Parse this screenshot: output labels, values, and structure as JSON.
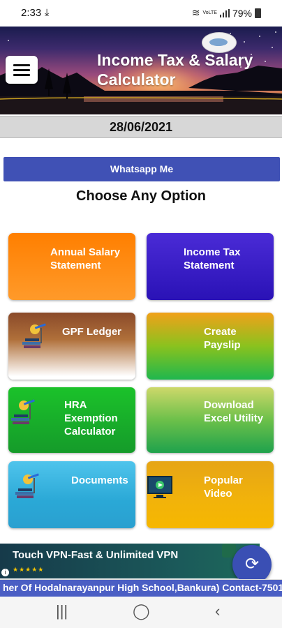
{
  "status_bar": {
    "time": "2:33",
    "network": "VoLTE",
    "battery": "79%"
  },
  "header": {
    "title_line1": "Income Tax & Salary",
    "title_line2": "Calculator"
  },
  "date": "28/06/2021",
  "whatsapp_label": "Whatsapp Me",
  "heading": "Choose Any Option",
  "options": {
    "annual": {
      "line1": "Annual Salary",
      "line2": "Statement"
    },
    "income": {
      "line1": "Income Tax",
      "line2": "Statement"
    },
    "gpf": {
      "line1": "GPF Ledger"
    },
    "payslip": {
      "line1": "Create",
      "line2": "Payslip"
    },
    "hra": {
      "line1": "HRA",
      "line2": "Exemption",
      "line3": "Calculator"
    },
    "excel": {
      "line1": "Download",
      "line2": "Excel Utility"
    },
    "docs": {
      "line1": "Documents"
    },
    "video": {
      "line1": "Popular",
      "line2": "Video"
    }
  },
  "ad": {
    "text": "Touch VPN-Fast & Unlimited VPN",
    "stars": "★★★★★"
  },
  "ticker_text": "her Of Hodalnarayanpur High School,Bankura)  Contact-7501",
  "icons": {
    "menu": "hamburger-icon",
    "fab": "refresh-icon",
    "tile_person": "teacher-books-icon",
    "tile_video": "video-screen-icon"
  },
  "colors": {
    "whatsapp_button": "#4051b5",
    "fab": "#3a4fb4",
    "ticker": "#4a5ec4"
  }
}
